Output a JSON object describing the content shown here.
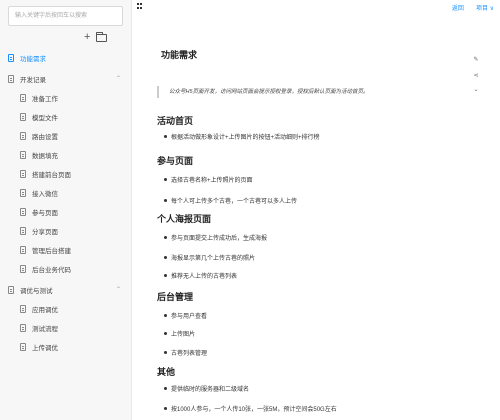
{
  "search": {
    "placeholder": "输入关键字后按回车以搜索"
  },
  "toolbar": {
    "add_label": "+"
  },
  "header": {
    "links": [
      "返回",
      "项目 ∨"
    ]
  },
  "sidebar": {
    "items": [
      {
        "label": "功能需求",
        "level": 0,
        "active": true
      },
      {
        "label": "开发记录",
        "level": 0,
        "group": true
      },
      {
        "label": "准备工作",
        "level": 1
      },
      {
        "label": "模型文件",
        "level": 1
      },
      {
        "label": "路由设置",
        "level": 1
      },
      {
        "label": "数据填充",
        "level": 1
      },
      {
        "label": "搭建前台页面",
        "level": 1
      },
      {
        "label": "接入微信",
        "level": 1
      },
      {
        "label": "参与页面",
        "level": 1
      },
      {
        "label": "分享页面",
        "level": 1
      },
      {
        "label": "管理后台搭建",
        "level": 1
      },
      {
        "label": "后台业务代码",
        "level": 1
      },
      {
        "label": "调优与测试",
        "level": 0,
        "group": true
      },
      {
        "label": "应用调优",
        "level": 1
      },
      {
        "label": "测试流程",
        "level": 1
      },
      {
        "label": "上传调优",
        "level": 1
      }
    ]
  },
  "doc": {
    "title": "功能需求",
    "quote": "公众号H5页面开发，访问网站页面会提示授权登录，授权后默认页面为活动首页。",
    "sections": [
      {
        "heading": "活动首页",
        "items": [
          "根据活动做形象设计+上传图片的按钮+活动细则+排行榜"
        ]
      },
      {
        "heading": "参与页面",
        "items": [
          "选择古巷名称+上传照片的页面",
          "每个人可上传多个古巷，一个古巷可以多人上传"
        ]
      },
      {
        "heading": "个人海报页面",
        "items": [
          "参与页面提交上传成功后，生成海报",
          "海报显示第几个上传古巷的照片",
          "推荐无人上传的古巷列表"
        ]
      },
      {
        "heading": "后台管理",
        "items": [
          "参与用户查看",
          "上传图片",
          "古巷列表管理"
        ]
      },
      {
        "heading": "其他",
        "items": [
          "提供临时的服务器和二级域名",
          "按1000人参与，一个人传10张，一张5M，预计空间会50G左右"
        ]
      }
    ]
  },
  "rail": {
    "icons": [
      "edit-icon",
      "share-icon",
      "more-icon"
    ]
  }
}
